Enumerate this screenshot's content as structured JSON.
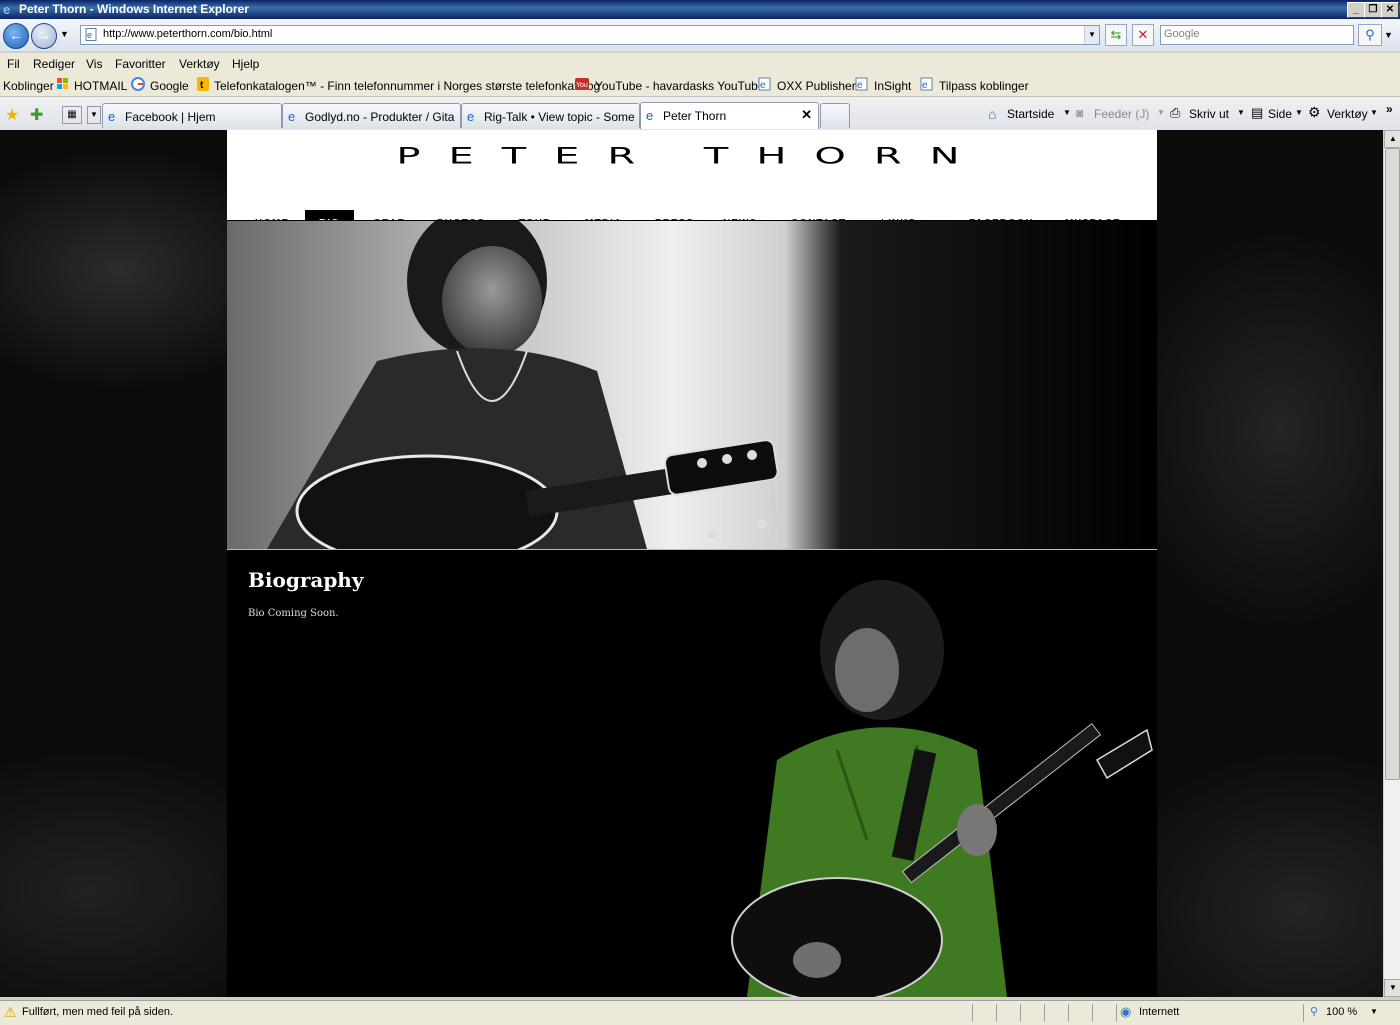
{
  "window": {
    "title": "Peter Thorn - Windows Internet Explorer"
  },
  "address": {
    "url": "http://www.peterthorn.com/bio.html",
    "search_placeholder": "Google"
  },
  "menu": [
    "Fil",
    "Rediger",
    "Vis",
    "Favoritter",
    "Verktøy",
    "Hjelp"
  ],
  "links": {
    "label": "Koblinger",
    "items": [
      "HOTMAIL",
      "Google",
      "Telefonkatalogen™ - Finn telefonnummer i Norges største telefonkatalog",
      "YouTube - havardasks YouTube",
      "OXX Publisher",
      "InSight",
      "Tilpass koblinger"
    ]
  },
  "tabs": [
    "Facebook | Hjem",
    "Godlyd.no - Produkter / Gita...",
    "Rig-Talk • View topic - Some ...",
    "Peter Thorn"
  ],
  "toolbar": {
    "home": "Startside",
    "feeds": "Feeder (J)",
    "print": "Skriv ut",
    "page": "Side",
    "tools": "Verktøy"
  },
  "site": {
    "logo": "PETER THORN",
    "nav": [
      "HOME",
      "BIO",
      "GEAR",
      "PHOTOS",
      "TOUR",
      "MEDIA",
      "PRESS",
      "NEWS",
      "CONTACT",
      "LINKS",
      "FACEBOOK",
      "MYSPACE"
    ],
    "active_nav": "BIO",
    "bio_title": "Biography",
    "bio_text": "Bio Coming Soon."
  },
  "status": {
    "text": "Fullført, men med feil på siden.",
    "zone": "Internett",
    "zoom": "100 %"
  }
}
